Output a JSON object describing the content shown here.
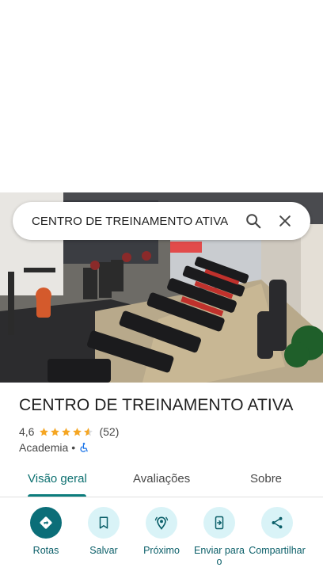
{
  "search": {
    "query": "CENTRO DE TREINAMENTO ATIVA"
  },
  "place": {
    "name": "CENTRO DE TREINAMENTO ATIVA",
    "rating": "4,6",
    "rating_value": 4.6,
    "stars_max": 5,
    "reviews": "(52)",
    "category": "Academia",
    "separator": "•",
    "accessibility_icon": "wheelchair-accessible-icon"
  },
  "tabs": [
    {
      "label": "Visão geral",
      "active": true
    },
    {
      "label": "Avaliações",
      "active": false
    },
    {
      "label": "Sobre",
      "active": false
    }
  ],
  "actions": [
    {
      "label": "Rotas",
      "icon": "directions-icon"
    },
    {
      "label": "Salvar",
      "icon": "bookmark-icon"
    },
    {
      "label": "Próximo",
      "icon": "nearby-icon"
    },
    {
      "label": "Enviar para o",
      "icon": "send-to-phone-icon"
    },
    {
      "label": "Compartilhar",
      "icon": "share-icon"
    }
  ],
  "colors": {
    "accent": "#0b6e78",
    "accent_light": "#d9f3f7",
    "star": "#f5a623",
    "accessibility": "#1a73e8"
  }
}
